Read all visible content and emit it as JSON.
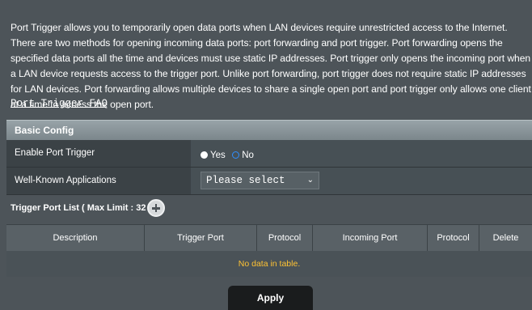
{
  "intro": {
    "text": "Port Trigger allows you to temporarily open data ports when LAN devices require unrestricted access to the Internet. There are two methods for opening incoming data ports: port forwarding and port trigger. Port forwarding opens the specified data ports all the time and devices must use static IP addresses. Port trigger only opens the incoming port when a LAN device requests access to the trigger port. Unlike port forwarding, port trigger does not require static IP addresses for LAN devices. Port forwarding allows multiple devices to share a single open port and port trigger only allows one client at a time to access the open port.",
    "faq_link": "Port Trigger FAQ"
  },
  "basic_config": {
    "header": "Basic Config",
    "enable_label": "Enable Port Trigger",
    "enable_options": [
      {
        "label": "Yes",
        "selected": true
      },
      {
        "label": "No",
        "selected": false
      }
    ],
    "apps_label": "Well-Known Applications",
    "apps_selected": "Please select"
  },
  "trigger_list": {
    "title": "Trigger Port List ( Max Limit : 32 )",
    "columns": [
      "Description",
      "Trigger Port",
      "Protocol",
      "Incoming Port",
      "Protocol",
      "Delete"
    ],
    "empty_text": "No data in table."
  },
  "apply_label": "Apply",
  "colors": {
    "background": "#4d5459",
    "accent_radio": "#2f8fff",
    "empty_text": "#ffc333"
  }
}
